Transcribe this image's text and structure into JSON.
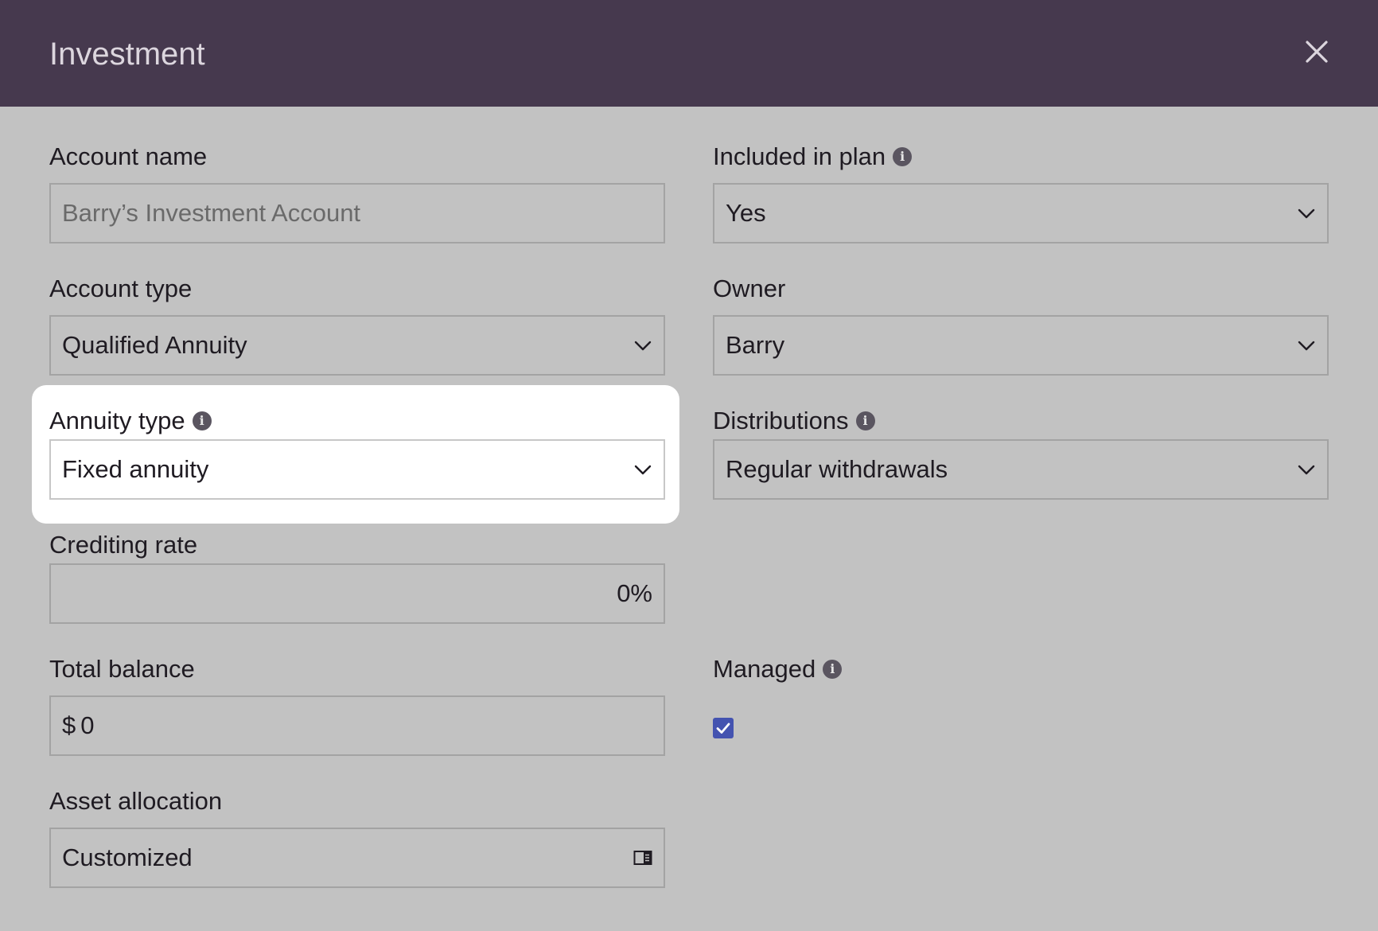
{
  "header": {
    "title": "Investment"
  },
  "fields": {
    "account_name": {
      "label": "Account name",
      "placeholder": "Barry’s Investment Account"
    },
    "included_in_plan": {
      "label": "Included in plan",
      "value": "Yes"
    },
    "account_type": {
      "label": "Account type",
      "value": "Qualified Annuity"
    },
    "owner": {
      "label": "Owner",
      "value": "Barry"
    },
    "annuity_type": {
      "label": "Annuity type",
      "value": "Fixed annuity"
    },
    "distributions": {
      "label": "Distributions",
      "value": "Regular withdrawals"
    },
    "crediting_rate": {
      "label": "Crediting rate",
      "value": "0%"
    },
    "total_balance": {
      "label": "Total balance",
      "currency": "$",
      "value": "0"
    },
    "managed": {
      "label": "Managed",
      "checked": true
    },
    "asset_allocation": {
      "label": "Asset allocation",
      "value": "Customized"
    }
  },
  "colors": {
    "header_bg": "#46394e",
    "body_bg": "#c2c2c2",
    "checkbox": "#4453b0",
    "highlight": "#ffffff"
  }
}
